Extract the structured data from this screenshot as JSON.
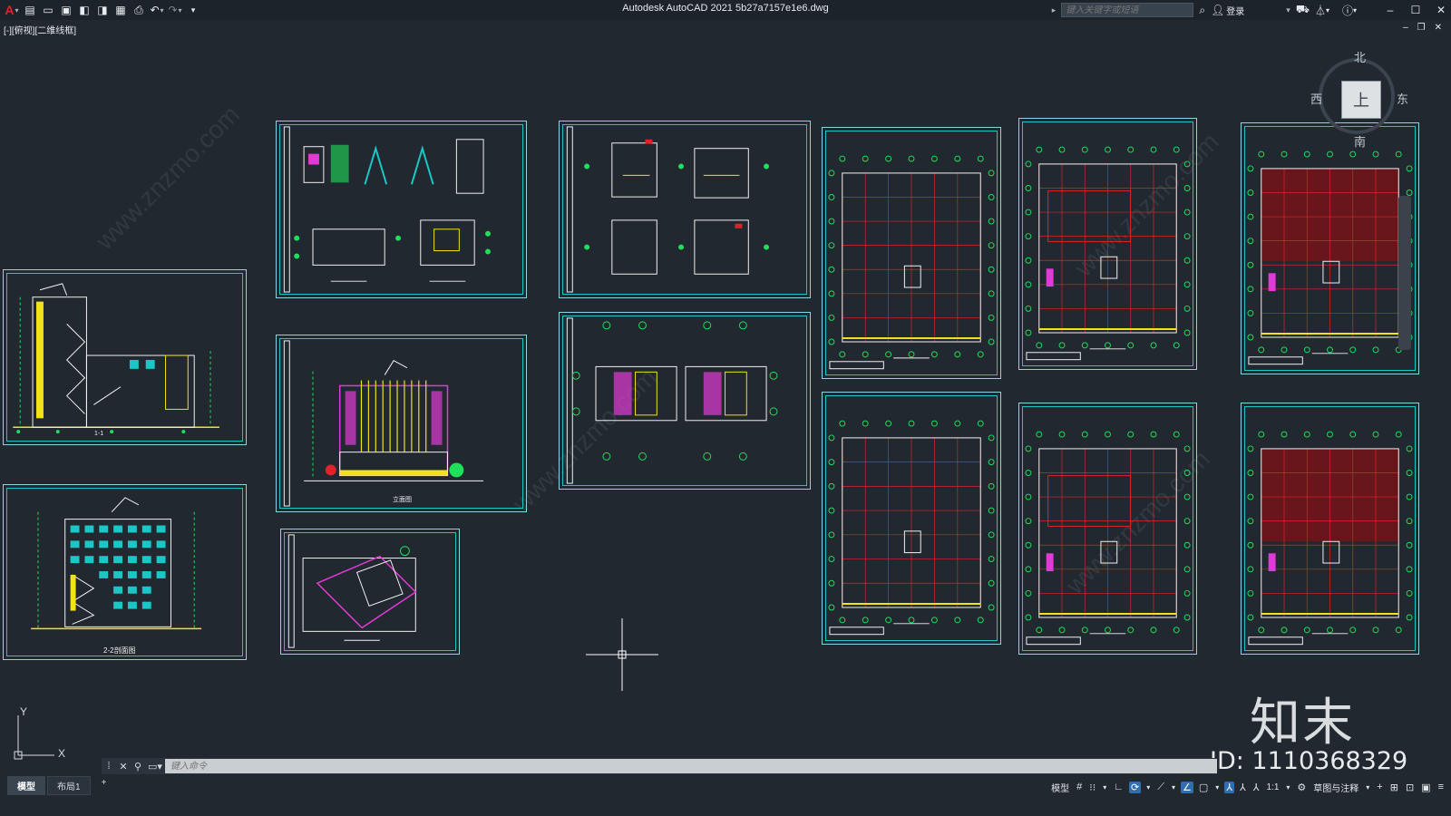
{
  "titlebar": {
    "app_title": "Autodesk AutoCAD 2021    5b27a7157e1e6.dwg",
    "search_placeholder": "键入关键字或短语",
    "login_label": "登录",
    "app_menu_letter": "A"
  },
  "viewport": {
    "label": "[-][俯视][二维线框]"
  },
  "viewcube": {
    "face": "上",
    "north": "北",
    "south": "南",
    "east": "东",
    "west": "西"
  },
  "sheets": {
    "s1_caption": "1-1",
    "s2_caption": "2-2剖面图",
    "s4_caption": "立面图"
  },
  "command_line": {
    "placeholder": "键入命令"
  },
  "layout_tabs": [
    "模型",
    "布局1",
    "+"
  ],
  "status_bar": {
    "model_label": "模型",
    "scale_label": "1:1",
    "workspace_label": "草图与注释"
  },
  "watermark": {
    "logo_text": "知末",
    "id_text": "ID: 1110368329",
    "site_text": "www.znzmo.com"
  },
  "colors": {
    "background": "#212830",
    "sheet_border": "#19c7c7",
    "grid_red": "#e0232b",
    "line_green": "#1fe05a",
    "magenta": "#e23ad6",
    "yellow": "#f2e21a"
  }
}
